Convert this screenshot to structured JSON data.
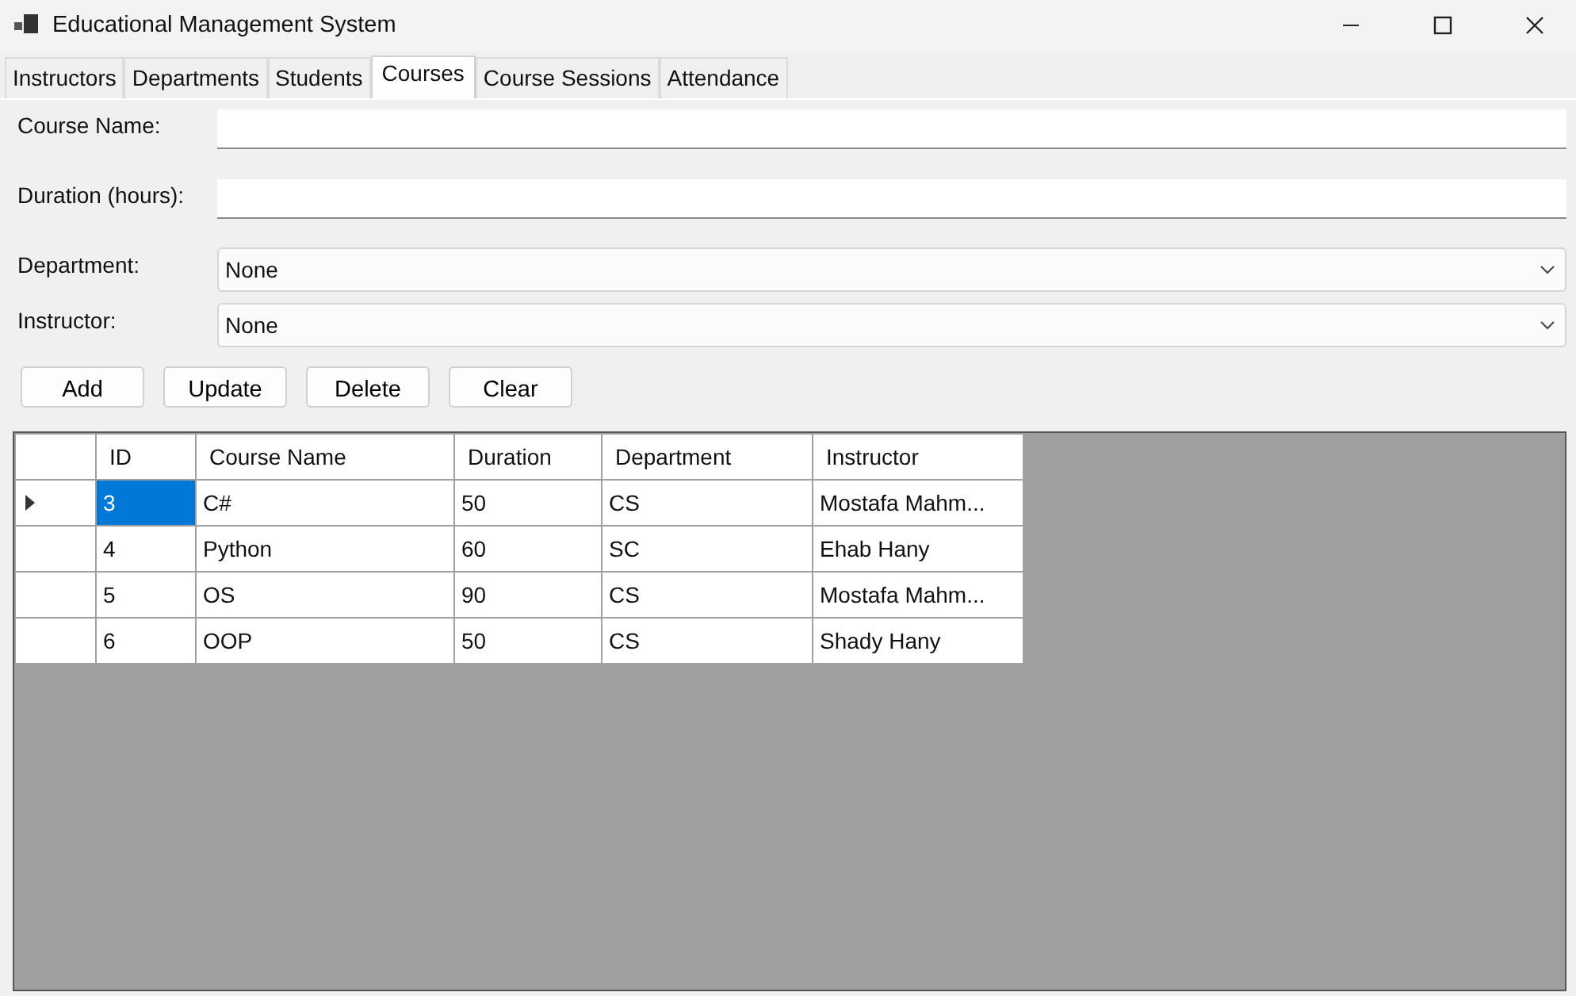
{
  "window": {
    "title": "Educational Management System"
  },
  "tabs": [
    {
      "label": "Instructors",
      "selected": false
    },
    {
      "label": "Departments",
      "selected": false
    },
    {
      "label": "Students",
      "selected": false
    },
    {
      "label": "Courses",
      "selected": true
    },
    {
      "label": "Course Sessions",
      "selected": false
    },
    {
      "label": "Attendance",
      "selected": false
    }
  ],
  "form": [
    {
      "kind": "text",
      "label": "Course Name:"
    },
    {
      "kind": "text",
      "label": "Duration (hours):"
    },
    {
      "kind": "combo",
      "label": "Department:",
      "value": "None"
    },
    {
      "kind": "combo",
      "label": "Instructor:",
      "value": "None"
    }
  ],
  "buttons": [
    "Add",
    "Update",
    "Delete",
    "Clear"
  ],
  "table": {
    "columns": [
      "ID",
      "Course Name",
      "Duration",
      "Department",
      "Instructor"
    ],
    "rows": [
      {
        "selected": true,
        "cells": [
          "3",
          "C#",
          "50",
          "CS",
          "Mostafa Mahm..."
        ]
      },
      {
        "selected": false,
        "cells": [
          "4",
          "Python",
          "60",
          "SC",
          "Ehab Hany"
        ]
      },
      {
        "selected": false,
        "cells": [
          "5",
          "OS",
          "90",
          "CS",
          "Mostafa Mahm..."
        ]
      },
      {
        "selected": false,
        "cells": [
          "6",
          "OOP",
          "50",
          "CS",
          "Shady Hany"
        ]
      }
    ]
  }
}
